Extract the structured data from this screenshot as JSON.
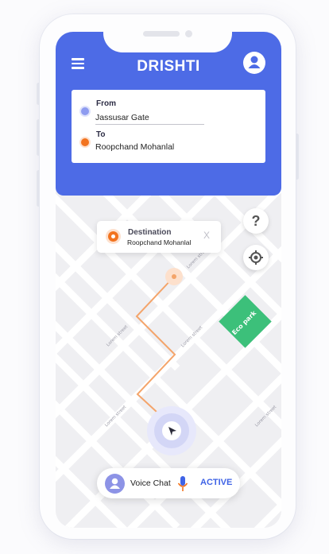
{
  "app": {
    "title": "DRISHTI"
  },
  "route": {
    "from_label": "From",
    "from_value": "Jassusar Gate",
    "to_label": "To",
    "to_value": "Roopchand Mohanlal"
  },
  "destination_popup": {
    "title": "Destination",
    "place": "Roopchand Mohanlal",
    "close": "X"
  },
  "map": {
    "street_labels": [
      "Lorem street",
      "Lorem street",
      "Lorem street",
      "Lorem street",
      "Lorem street"
    ],
    "park_label": "Eco park",
    "route_color": "#f4a46a",
    "park_color": "#3cc07a"
  },
  "controls": {
    "help": "?"
  },
  "voice": {
    "label": "Voice Chat",
    "status": "ACTIVE"
  },
  "colors": {
    "primary": "#4d6be6",
    "accent_orange": "#f2731f",
    "active_blue": "#3f63e6"
  }
}
